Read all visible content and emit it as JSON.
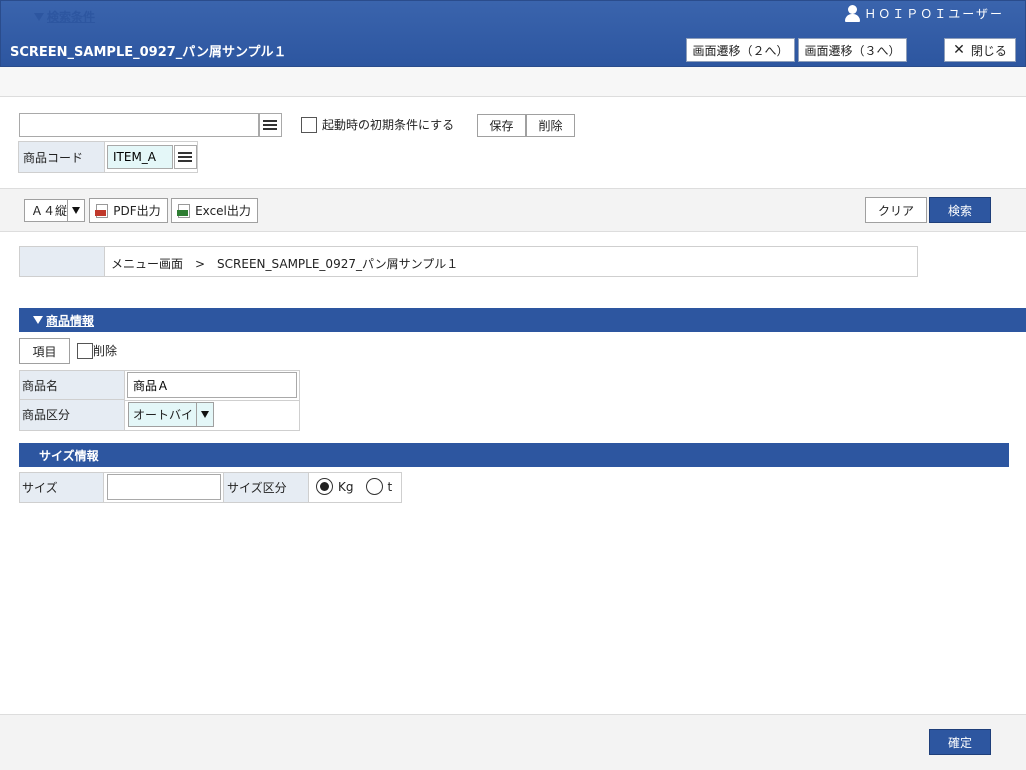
{
  "header": {
    "user_name": "ＨＯＩＰＯＩユーザー",
    "title": "SCREEN_SAMPLE_0927_パン屑サンプル１",
    "nav2_label": "画面遷移（２へ）",
    "nav3_label": "画面遷移（３へ）",
    "close_label": "閉じる"
  },
  "search": {
    "section_label": "検索条件",
    "condition_value": "",
    "initial_condition_label": "起動時の初期条件にする",
    "save_label": "保存",
    "delete_label": "削除",
    "code_label": "商品コード",
    "code_value": "ITEM_A"
  },
  "toolbar": {
    "paper_size": "Ａ４縦",
    "pdf_label": "PDF出力",
    "excel_label": "Excel出力",
    "clear_label": "クリア",
    "search_label": "検索"
  },
  "breadcrumb": {
    "text": "メニュー画面　>　SCREEN_SAMPLE_0927_パン屑サンプル１"
  },
  "product": {
    "section_label": "商品情報",
    "items_label": "項目",
    "delete_label": "削除",
    "name_label": "商品名",
    "name_value": "商品Ａ",
    "category_label": "商品区分",
    "category_value": "オートバイ"
  },
  "size": {
    "section_label": "サイズ情報",
    "size_label": "サイズ",
    "size_value": "",
    "category_label": "サイズ区分",
    "options": [
      "Kg",
      "t"
    ],
    "selected": "Kg"
  },
  "footer": {
    "confirm_label": "確定"
  },
  "colors": {
    "header_blue": "#2d56a0",
    "label_bg": "#e6ecf3",
    "input_highlight": "#e4f7f8"
  }
}
